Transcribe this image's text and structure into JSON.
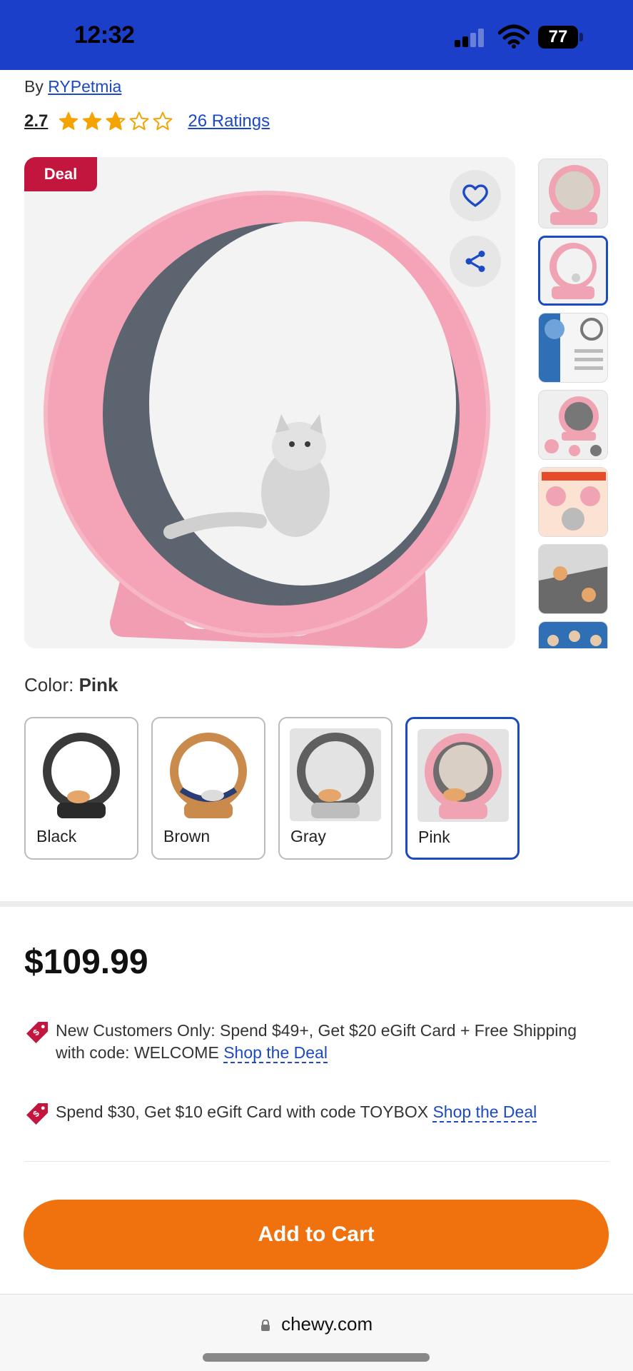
{
  "status_bar": {
    "time": "12:32",
    "battery": "77"
  },
  "product": {
    "by_label": "By",
    "brand": "RYPetmia",
    "rating": "2.7",
    "rating_value": 2.7,
    "rating_max": 5,
    "ratings_count": "26 Ratings",
    "deal_badge": "Deal",
    "main_image": "pink-cat-wheel-photo",
    "thumbnails": [
      "thumb-1",
      "thumb-2-selected",
      "thumb-3",
      "thumb-4",
      "thumb-5",
      "thumb-6",
      "thumb-7"
    ]
  },
  "color": {
    "label": "Color:",
    "selected": "Pink",
    "options": [
      {
        "name": "Black",
        "ring": "#3a3a3a",
        "base": "#2a2a2a",
        "bg": "#ffffff"
      },
      {
        "name": "Brown",
        "ring": "#c98a4b",
        "base": "#c98a4b",
        "bg": "#ffffff"
      },
      {
        "name": "Gray",
        "ring": "#5f5f5f",
        "base": "#bdbdbd",
        "bg": "#e3e3e3"
      },
      {
        "name": "Pink",
        "ring": "#f0a3b3",
        "base": "#f0a3b3",
        "bg": "#e3e3e3"
      }
    ]
  },
  "price": "$109.99",
  "promos": [
    {
      "text": "New Customers Only: Spend $49+, Get $20 eGift Card + Free Shipping with code: WELCOME",
      "link": "Shop the Deal"
    },
    {
      "text": "Spend $30, Get $10 eGift Card with code TOYBOX",
      "link": "Shop the Deal"
    }
  ],
  "cart_button": "Add to Cart",
  "browser": {
    "url": "chewy.com"
  },
  "colors": {
    "brand_blue": "#1c3fc9",
    "link_blue": "#1c49c4",
    "deal_red": "#c3163e",
    "cta_orange": "#f0720f",
    "star_gold": "#f5a300"
  }
}
